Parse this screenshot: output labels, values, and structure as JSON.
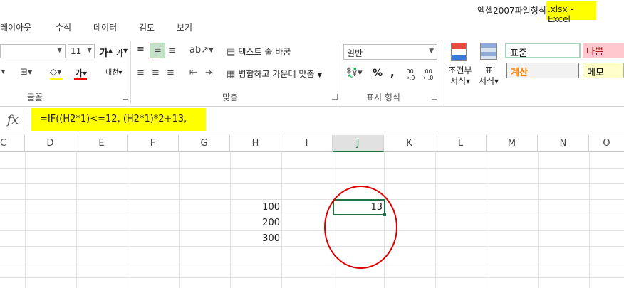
{
  "window": {
    "title": "엑셀2007파일형식",
    "title_highlight": ".xlsx - Excel"
  },
  "tabs": [
    "레이아웃",
    "수식",
    "데이터",
    "검토",
    "보기"
  ],
  "ribbon": {
    "font_size": "11",
    "grow_font": "가",
    "shrink_font": "가",
    "font_color_label": "가",
    "phonetic_label": "내천",
    "wrap_text": "텍스트 줄 바꿈",
    "merge_center": "병합하고 가운데 맞춤",
    "number_format": "일반",
    "percent": "%",
    "comma": ",",
    "inc_decimal": ".00 →.0",
    "dec_decimal": ".00 ←.0",
    "conditional_format": [
      "조건부",
      "서식"
    ],
    "table_format": [
      "표",
      "서식"
    ],
    "groups": {
      "font": "글꼴",
      "alignment": "맞춤",
      "number": "표시 형식"
    },
    "styles": [
      {
        "label": "표준",
        "color": "#000000",
        "bg": "#ffffff",
        "border": "#a6d5bf"
      },
      {
        "label": "나쁨",
        "color": "#9c0006",
        "bg": "#ffc7ce",
        "border": "#ffc7ce"
      },
      {
        "label": "계산",
        "color": "#fa7d00",
        "bg": "#f2f2f2",
        "border": "#7f7f7f"
      },
      {
        "label": "메모",
        "color": "#000000",
        "bg": "#ffffcc",
        "border": "#b2b2b2"
      }
    ]
  },
  "formula_bar": {
    "fx": "fx",
    "formula": "=IF((H2*1)<=12, (H2*1)*2+13,"
  },
  "columns": [
    "C",
    "D",
    "E",
    "F",
    "G",
    "H",
    "I",
    "J",
    "K",
    "L",
    "M",
    "N",
    "O"
  ],
  "selected_column": "J",
  "cells": {
    "H3": "100",
    "H4": "200",
    "H5": "300",
    "J3": "13"
  },
  "colors": {
    "accent": "#217346",
    "highlight": "#ffff00",
    "annotation": "#dd0000"
  }
}
